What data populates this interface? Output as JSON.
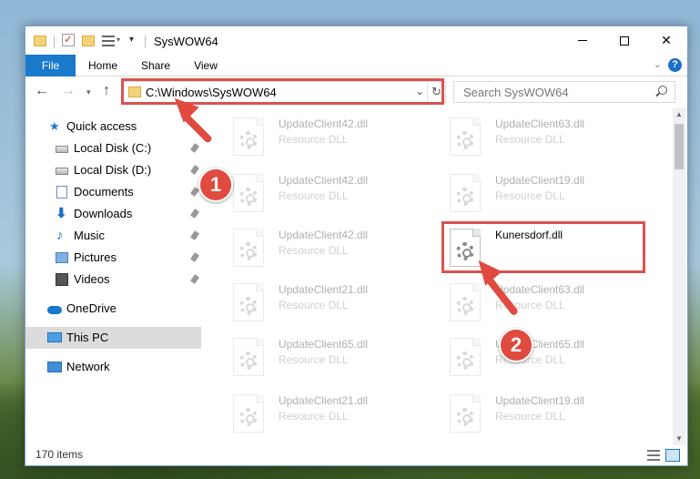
{
  "window": {
    "title": "SysWOW64"
  },
  "ribbon": {
    "tabs": [
      "File",
      "Home",
      "Share",
      "View"
    ]
  },
  "navigation": {
    "address": "C:\\Windows\\SysWOW64",
    "search_placeholder": "Search SysWOW64"
  },
  "sidebar": {
    "items": [
      {
        "label": "Quick access",
        "icon": "star-icon"
      },
      {
        "label": "Local Disk (C:)",
        "icon": "disk-icon"
      },
      {
        "label": "Local Disk (D:)",
        "icon": "disk-icon"
      },
      {
        "label": "Documents",
        "icon": "documents-icon"
      },
      {
        "label": "Downloads",
        "icon": "downloads-icon"
      },
      {
        "label": "Music",
        "icon": "music-icon"
      },
      {
        "label": "Pictures",
        "icon": "pictures-icon"
      },
      {
        "label": "Videos",
        "icon": "videos-icon"
      },
      {
        "label": "OneDrive",
        "icon": "onedrive-icon"
      },
      {
        "label": "This PC",
        "icon": "pc-icon",
        "selected": true
      },
      {
        "label": "Network",
        "icon": "network-icon"
      }
    ]
  },
  "files": {
    "left": [
      {
        "name": "UpdateClient42.dll",
        "desc": "Resource DLL"
      },
      {
        "name": "UpdateClient42.dll",
        "desc": "Resource DLL"
      },
      {
        "name": "UpdateClient42.dll",
        "desc": "Resource DLL"
      },
      {
        "name": "UpdateClient21.dll",
        "desc": "Resource DLL"
      },
      {
        "name": "UpdateClient65.dll",
        "desc": "Resource DLL"
      },
      {
        "name": "UpdateClient21.dll",
        "desc": "Resource DLL"
      }
    ],
    "right": [
      {
        "name": "UpdateClient63.dll",
        "desc": "Resource DLL"
      },
      {
        "name": "UpdateClient19.dll",
        "desc": "Resource DLL"
      },
      {
        "name": "Kunersdorf.dll",
        "desc": "",
        "highlighted": true
      },
      {
        "name": "UpdateClient63.dll",
        "desc": "Resource DLL"
      },
      {
        "name": "UpdateClient65.dll",
        "desc": "Resource DLL"
      },
      {
        "name": "UpdateClient19.dll",
        "desc": "Resource DLL"
      }
    ]
  },
  "status": {
    "item_count": "170 items"
  },
  "annotations": {
    "step1": "1",
    "step2": "2",
    "color": "#e04a3f"
  }
}
